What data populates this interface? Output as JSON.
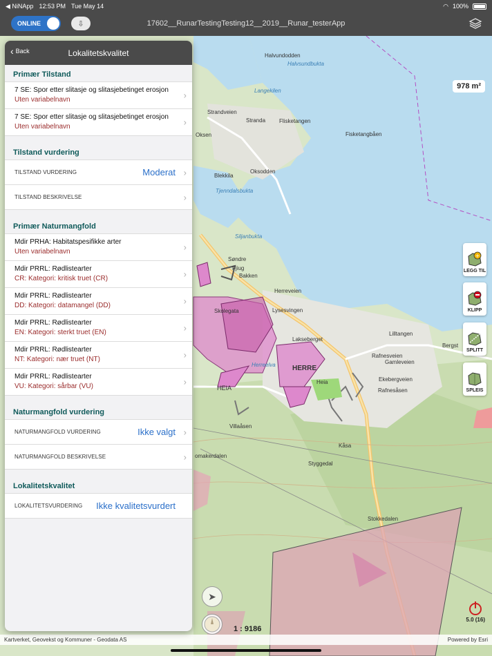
{
  "status": {
    "carrier": "◀ NiNApp",
    "time": "12:53 PM",
    "date": "Tue May 14",
    "battery": "100%"
  },
  "app_bar": {
    "online_label": "ONLINE",
    "title": "17602__RunarTestingTesting12__2019__Runar_testerApp"
  },
  "map": {
    "area_badge": "978 m²",
    "scale": "1 : 9186",
    "gps_value": "5.0 (16)",
    "attribution_left": "Kartverket, Geovekst og Kommuner - Geodata AS",
    "attribution_right": "Powered by Esri",
    "tools": [
      {
        "label": "LEGG TIL",
        "icon": "add-polygon-icon"
      },
      {
        "label": "KLIPP",
        "icon": "cut-polygon-icon"
      },
      {
        "label": "SPLITT",
        "icon": "split-polygon-icon"
      },
      {
        "label": "SPLEIS",
        "icon": "merge-polygon-icon"
      }
    ],
    "place_labels": [
      "Halvsundbukta",
      "Langekilen",
      "Strandveien",
      "Stranda",
      "Flisketangen",
      "Fisketangbåen",
      "Oksen",
      "Blekkila",
      "Oksodden",
      "Tjenndalsbukta",
      "Skjærgårdsveien",
      "Siljanbukta",
      "Søndre",
      "Bakken",
      "Herreveien",
      "Skolegata",
      "Lakseberget",
      "Lysesvingen",
      "Herreelva",
      "HERRE",
      "Heia",
      "HEIA",
      "Villaåsen",
      "Gamleveien",
      "Rafnesveien",
      "Ekebergveien",
      "Rafnesåsen",
      "Styggedal",
      "Kåsa",
      "Stokkedalen",
      "Bergst",
      "Rafnesveien"
    ]
  },
  "panel": {
    "back_label": "Back",
    "title": "Lokalitetskvalitet",
    "sections": [
      {
        "title": "Primær Tilstand",
        "rows": [
          {
            "primary": "7 SE: Spor etter slitasje og slitasjebetinget erosjon",
            "secondary": "Uten variabelnavn"
          },
          {
            "primary": "7 SE: Spor etter slitasje og slitasjebetinget erosjon",
            "secondary": "Uten variabelnavn"
          }
        ]
      },
      {
        "title": "Tilstand vurdering",
        "kv": [
          {
            "key": "TILSTAND VURDERING",
            "value": "Moderat"
          },
          {
            "key": "TILSTAND BESKRIVELSE",
            "value": ""
          }
        ]
      },
      {
        "title": "Primær Naturmangfold",
        "rows": [
          {
            "primary": "Mdir PRHA: Habitatspesifikke arter",
            "secondary": "Uten variabelnavn"
          },
          {
            "primary": "Mdir PRRL: Rødlistearter",
            "secondary": "CR: Kategori: kritisk truet (CR)"
          },
          {
            "primary": "Mdir PRRL: Rødlistearter",
            "secondary": "DD: Kategori: datamangel (DD)"
          },
          {
            "primary": "Mdir PRRL: Rødlistearter",
            "secondary": "EN: Kategori: sterkt truet (EN)"
          },
          {
            "primary": "Mdir PRRL: Rødlistearter",
            "secondary": "NT: Kategori: nær truet (NT)"
          },
          {
            "primary": "Mdir PRRL: Rødlistearter",
            "secondary": "VU: Kategori: sårbar (VU)"
          }
        ]
      },
      {
        "title": "Naturmangfold vurdering",
        "kv": [
          {
            "key": "NATURMANGFOLD VURDERING",
            "value": "Ikke valgt"
          },
          {
            "key": "NATURMANGFOLD BESKRIVELSE",
            "value": ""
          }
        ]
      },
      {
        "title": "Lokalitetskvalitet",
        "kv": [
          {
            "key": "LOKALITETSVURDERING",
            "value": "Ikke kvalitetsvurdert"
          }
        ]
      }
    ]
  },
  "colors": {
    "accent": "#2e73c7",
    "section_title": "#0f5a5a",
    "secondary_text": "#9a2b2b",
    "value_text": "#2a6fc9",
    "header": "#4a4a4a"
  }
}
